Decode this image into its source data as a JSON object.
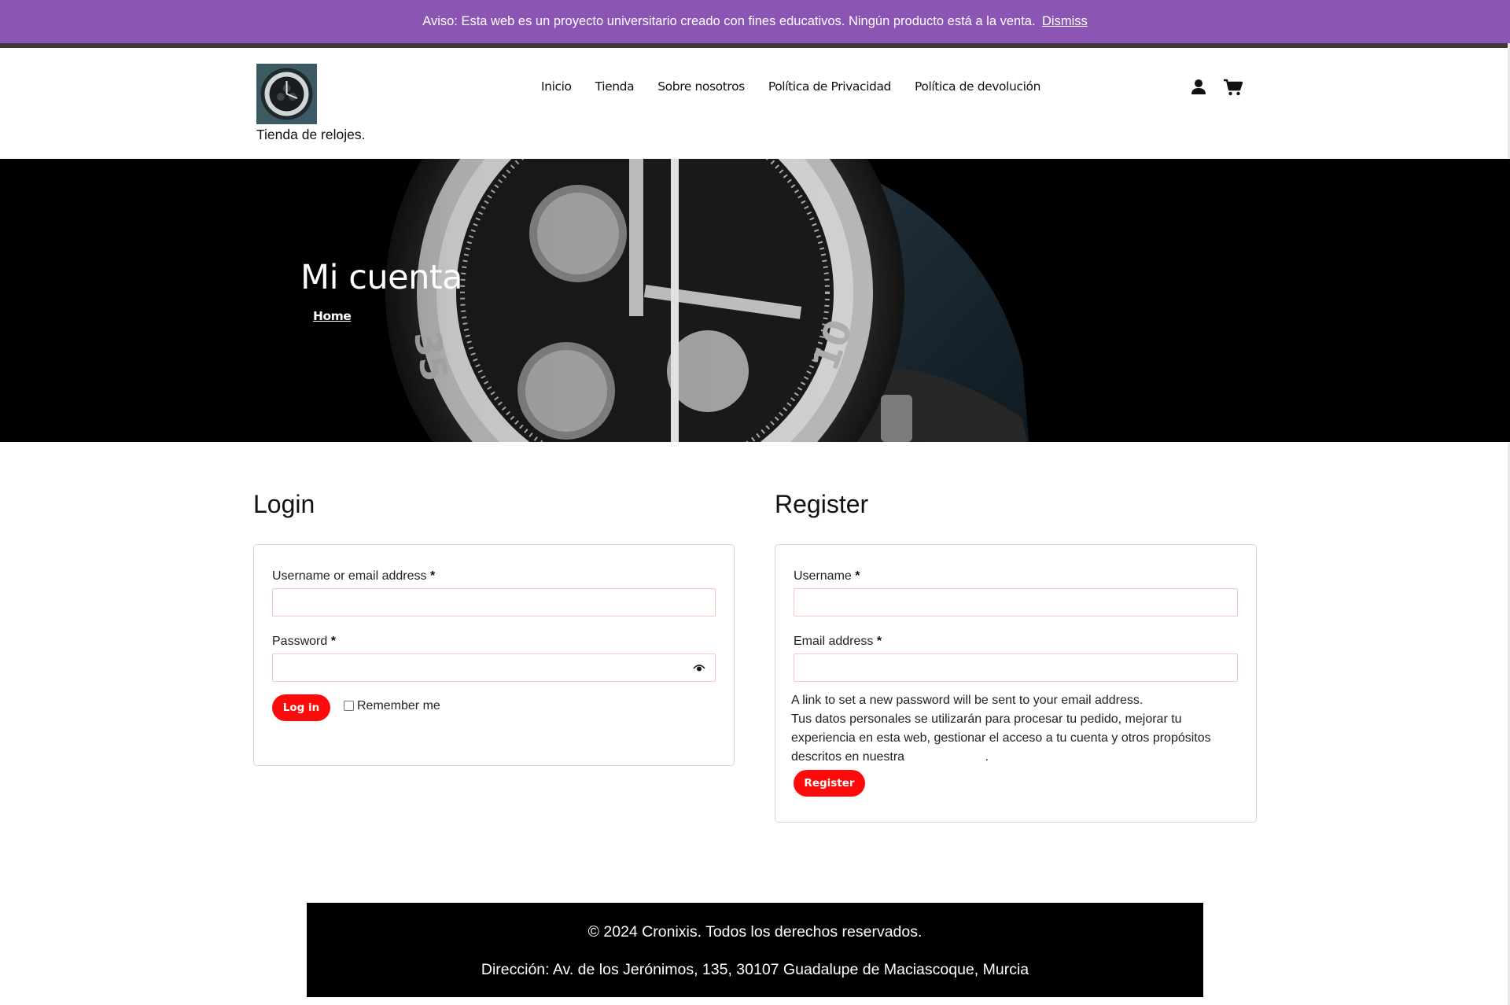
{
  "notice": {
    "text": "Aviso: Esta web es un proyecto universitario creado con fines educativos. Ningún producto está a la venta.",
    "dismiss": "Dismiss"
  },
  "header": {
    "tagline": "Tienda de relojes.",
    "nav": [
      "Inicio",
      "Tienda",
      "Sobre nosotros",
      "Política de Privacidad",
      "Política de devolución"
    ],
    "icons": [
      "user-icon",
      "cart-icon"
    ]
  },
  "hero": {
    "title": "Mi cuenta",
    "breadcrumb": "Home"
  },
  "login": {
    "title": "Login",
    "username_label": "Username or email address",
    "password_label": "Password",
    "required_mark": "*",
    "submit": "Log in",
    "remember": "Remember me"
  },
  "register": {
    "title": "Register",
    "username_label": "Username",
    "email_label": "Email address",
    "required_mark": "*",
    "password_note": "A link to set a new password will be sent to your email address.",
    "privacy_text": "Tus datos personales se utilizarán para procesar tu pedido, mejorar tu experiencia en esta web, gestionar el acceso a tu cuenta y otros propósitos descritos en nuestra",
    "privacy_end": ".",
    "submit": "Register"
  },
  "footer": {
    "copyright": "© 2024 Cronixis. Todos los derechos reservados.",
    "address": "Dirección: Av. de los Jerónimos, 135, 30107 Guadalupe de Maciascoque, Murcia"
  },
  "colors": {
    "notice_bg": "#8a55b3",
    "button": "#ff0a0a",
    "input_border": "#f3c9c0",
    "footer_bg": "#000000"
  }
}
